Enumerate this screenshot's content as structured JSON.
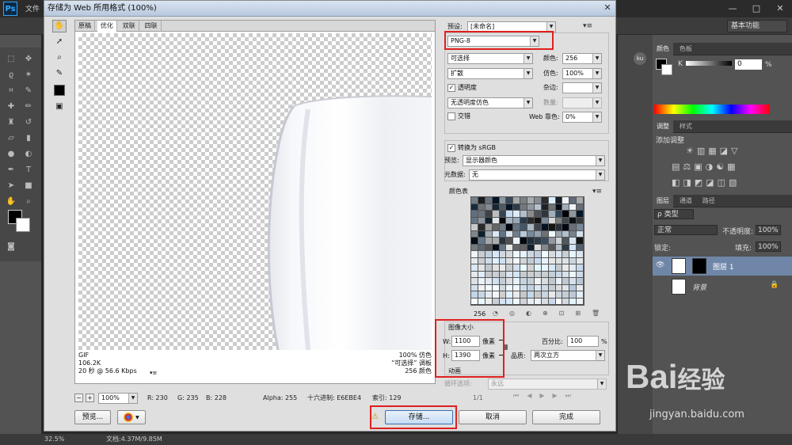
{
  "app": {
    "logo": "Ps",
    "menu_first": "文件",
    "workspace": "基本功能",
    "win_controls": [
      "—",
      "□",
      "✕"
    ],
    "status_zoom": "32.5%",
    "status_doc": "文档:4.37M/9.85M"
  },
  "dialog": {
    "title": "存储为 Web 所用格式 (100%)",
    "close": "✕",
    "view_tabs": [
      "原稿",
      "优化",
      "双联",
      "四联"
    ],
    "info_left": [
      "GIF",
      "106.2K",
      "20 秒 @ 56.6 Kbps"
    ],
    "info_right": [
      "100% 仿色",
      "“可选择” 调板",
      "256 颜色"
    ],
    "zoom": "100%",
    "readout": {
      "r": "R: 230",
      "g": "G: 235",
      "b": "B: 228",
      "alpha": "Alpha: 255",
      "hex": "十六进制: E6EBE4",
      "index": "索引: 129"
    },
    "buttons": {
      "preview": "预览...",
      "save": "存储...",
      "cancel": "取消",
      "done": "完成"
    },
    "settings": {
      "preset_label": "预设:",
      "preset_value": "[未命名]",
      "format": "PNG-8",
      "reduction": "可选择",
      "dither_algo": "扩散",
      "transparency": "透明度",
      "transparency_dither": "无透明度仿色",
      "interlaced": "交错",
      "colors_label": "颜色:",
      "colors_value": "256",
      "dither_label": "仿色:",
      "dither_value": "100%",
      "matte_label": "杂边:",
      "amount_label": "数量:",
      "web_snap_label": "Web 靠色:",
      "web_snap_value": "0%",
      "convert_srgb": "转换为 sRGB",
      "preview_label": "预览:",
      "preview_value": "显示器颜色",
      "metadata_label": "元数据:",
      "metadata_value": "无",
      "color_table_label": "颜色表",
      "color_count": "256"
    },
    "image_size": {
      "title": "图像大小",
      "w_label": "W:",
      "w_value": "1100",
      "h_label": "H:",
      "h_value": "1390",
      "unit": "像素",
      "percent_label": "百分比:",
      "percent_value": "100",
      "percent_unit": "%",
      "quality_label": "品质:",
      "quality_value": "两次立方"
    },
    "animation": {
      "title": "动画",
      "loop_label": "循环选项:",
      "loop_value": "永远",
      "frame": "1/1"
    }
  },
  "panels": {
    "color_tabs": [
      "颜色",
      "色板"
    ],
    "color_k": "K",
    "color_k_value": "0",
    "color_k_unit": "%",
    "adjust_tabs": [
      "调整",
      "样式"
    ],
    "adjust_title": "添加调整",
    "layers_tabs": [
      "图层",
      "通道",
      "路径"
    ],
    "layers_kind": "ρ 类型",
    "blend_mode": "正常",
    "opacity_label": "不透明度:",
    "opacity_value": "100%",
    "lock_label": "锁定:",
    "fill_label": "填充:",
    "fill_value": "100%",
    "layers": [
      {
        "name": "图层 1"
      },
      {
        "name": "背景"
      }
    ]
  },
  "watermark": {
    "brand": "Bai",
    "brand2": "经验",
    "url": "jingyan.baidu.com"
  },
  "colors": {
    "accent_red": "#e02020",
    "selected_layer": "#6f86a8"
  }
}
